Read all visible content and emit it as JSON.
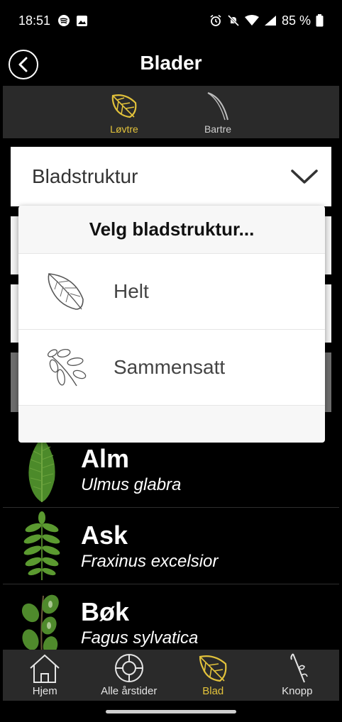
{
  "status": {
    "time": "18:51",
    "battery": "85 %"
  },
  "header": {
    "title": "Blader"
  },
  "type_tabs": [
    {
      "label": "Løvtre",
      "active": true
    },
    {
      "label": "Bartre",
      "active": false
    }
  ],
  "filter": {
    "structure_label": "Bladstruktur"
  },
  "dropdown": {
    "title": "Velg bladstruktur...",
    "options": [
      {
        "label": "Helt",
        "icon": "simple-leaf-icon"
      },
      {
        "label": "Sammensatt",
        "icon": "compound-leaf-icon"
      }
    ]
  },
  "species": [
    {
      "common": "Alm",
      "latin": "Ulmus glabra"
    },
    {
      "common": "Ask",
      "latin": "Fraxinus excelsior"
    },
    {
      "common": "Bøk",
      "latin": "Fagus sylvatica"
    }
  ],
  "bottom_nav": [
    {
      "label": "Hjem",
      "active": false
    },
    {
      "label": "Alle årstider",
      "active": false
    },
    {
      "label": "Blad",
      "active": true
    },
    {
      "label": "Knopp",
      "active": false
    }
  ],
  "colors": {
    "accent": "#e2c23b",
    "tab_bg": "#2a2a2a"
  }
}
